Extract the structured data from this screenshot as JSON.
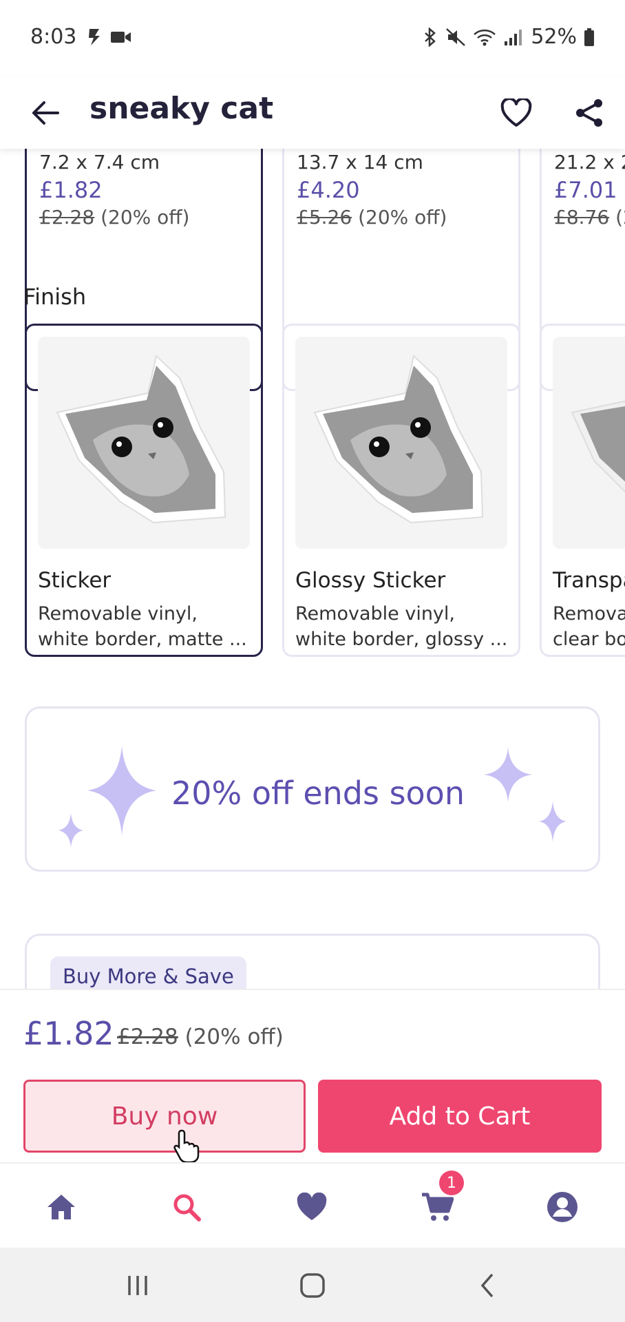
{
  "status_bar": {
    "time": "8:03",
    "battery": "52%"
  },
  "app_bar": {
    "title": "sneaky cat"
  },
  "sizes": [
    {
      "dimension": "7.2 x 7.4 cm",
      "price": "£1.82",
      "old_price": "£2.28",
      "discount": "(20% off)",
      "selected": true
    },
    {
      "dimension": "13.7 x 14 cm",
      "price": "£4.20",
      "old_price": "£5.26",
      "discount": "(20% off)",
      "selected": false
    },
    {
      "dimension": "21.2 x 2",
      "price": "£7.01",
      "old_price": "£8.76",
      "discount": "(2",
      "selected": false
    }
  ],
  "finish": {
    "label": "Finish",
    "options": [
      {
        "name": "Sticker",
        "desc_line1": "Removable vinyl,",
        "desc_line2": "white border, matte ...",
        "selected": true
      },
      {
        "name": "Glossy Sticker",
        "desc_line1": "Removable vinyl,",
        "desc_line2": "white border, glossy ...",
        "selected": false
      },
      {
        "name": "Transpa",
        "desc_line1": "Remova",
        "desc_line2": "clear bo",
        "selected": false
      }
    ]
  },
  "promo": {
    "text": "20% off ends soon"
  },
  "buy_more": {
    "chip": "Buy More & Save"
  },
  "purchase": {
    "price": "£1.82",
    "old_price": "£2.28",
    "discount": "(20% off)",
    "buy_now_label": "Buy now",
    "add_to_cart_label": "Add to Cart"
  },
  "bottom_nav": {
    "items": [
      "home-icon",
      "search-icon",
      "heart-icon",
      "cart-icon",
      "account-icon"
    ],
    "cart_badge": "1"
  },
  "colors": {
    "accent_purple": "#5a4fa8",
    "cta_pink": "#ef4670",
    "selected_border": "#27244a",
    "sparkle": "#c7c0f5"
  }
}
